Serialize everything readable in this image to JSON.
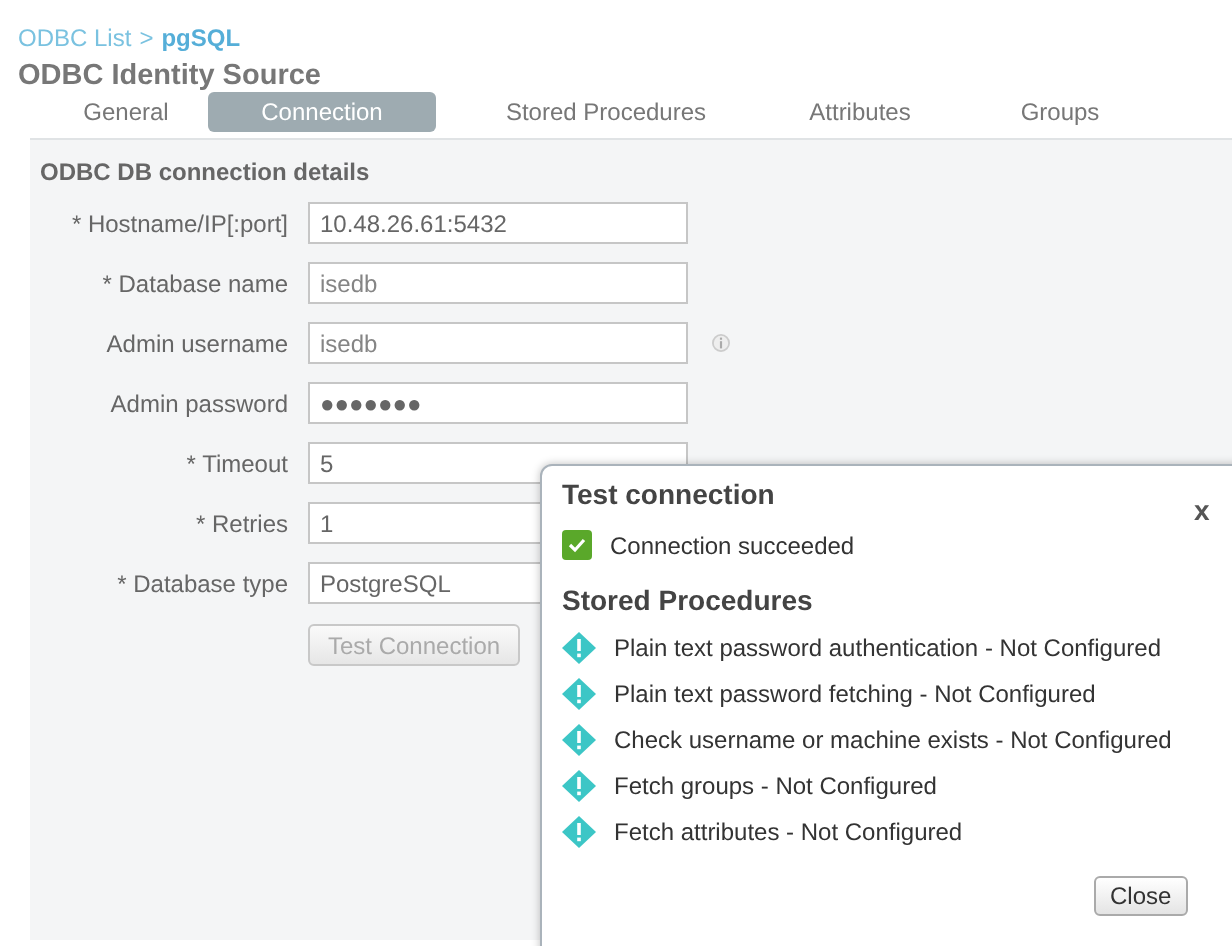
{
  "breadcrumb": {
    "parent": "ODBC List",
    "separator": ">",
    "current": "pgSQL"
  },
  "title": "ODBC Identity Source",
  "tabs": [
    {
      "label": "General",
      "selected": false
    },
    {
      "label": "Connection",
      "selected": true
    },
    {
      "label": "Stored Procedures",
      "selected": false
    },
    {
      "label": "Attributes",
      "selected": false
    },
    {
      "label": "Groups",
      "selected": false
    }
  ],
  "section": "ODBC DB connection details",
  "fields": [
    {
      "label": "* Hostname/IP[:port]",
      "value": "10.48.26.61:5432",
      "dimmed": false,
      "info": false
    },
    {
      "label": "* Database name",
      "value": "isedb",
      "dimmed": true,
      "info": false
    },
    {
      "label": "Admin username",
      "value": "isedb",
      "dimmed": true,
      "info": true
    },
    {
      "label": "Admin password",
      "value": "●●●●●●●",
      "dimmed": false,
      "info": false
    },
    {
      "label": "* Timeout",
      "value": "5",
      "dimmed": false,
      "info": false
    },
    {
      "label": "* Retries",
      "value": "1",
      "dimmed": false,
      "info": false
    },
    {
      "label": "* Database type",
      "value": "PostgreSQL",
      "dimmed": false,
      "info": false
    }
  ],
  "test_button": {
    "label": "Test Connection",
    "disabled": true
  },
  "dialog": {
    "title": "Test connection",
    "close": "x",
    "status": "Connection succeeded",
    "procedures_title": "Stored Procedures",
    "procedures": [
      "Plain text password authentication - Not Configured",
      "Plain text password fetching - Not Configured",
      "Check username or machine exists - Not Configured",
      "Fetch groups - Not Configured",
      "Fetch attributes - Not Configured"
    ],
    "button": "Close"
  }
}
